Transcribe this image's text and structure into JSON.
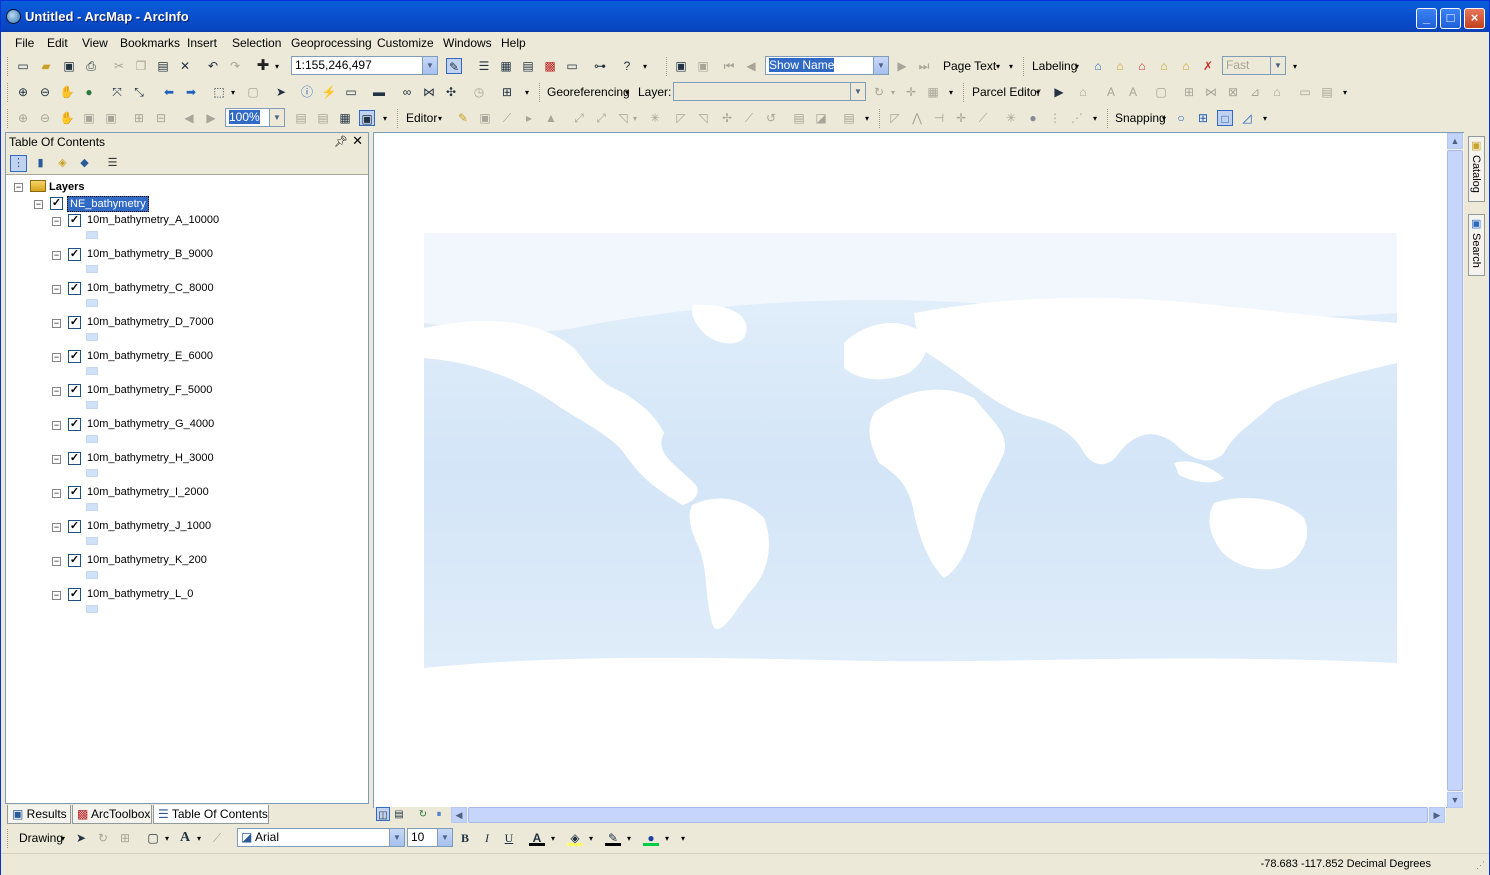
{
  "window": {
    "title": "Untitled - ArcMap - ArcInfo",
    "minimize": "_",
    "maximize": "□",
    "close": "×"
  },
  "menu": [
    "File",
    "Edit",
    "View",
    "Bookmarks",
    "Insert",
    "Selection",
    "Geoprocessing",
    "Customize",
    "Windows",
    "Help"
  ],
  "toolbar1": {
    "scale": "1:155,246,497",
    "label_field": "Show Name",
    "page_text": "Page Text",
    "labeling": "Labeling",
    "label_quality": "Fast"
  },
  "toolbar2": {
    "georeferencing": "Georeferencing",
    "layer_label": "Layer:",
    "layer_value": "",
    "parcel_editor": "Parcel Editor"
  },
  "toolbar3": {
    "zoom": "100%",
    "editor": "Editor",
    "snapping": "Snapping"
  },
  "toc": {
    "title": "Table Of Contents",
    "root": "Layers",
    "group": "NE_bathymetry",
    "layers": [
      "10m_bathymetry_A_10000",
      "10m_bathymetry_B_9000",
      "10m_bathymetry_C_8000",
      "10m_bathymetry_D_7000",
      "10m_bathymetry_E_6000",
      "10m_bathymetry_F_5000",
      "10m_bathymetry_G_4000",
      "10m_bathymetry_H_3000",
      "10m_bathymetry_I_2000",
      "10m_bathymetry_J_1000",
      "10m_bathymetry_K_200",
      "10m_bathymetry_L_0"
    ]
  },
  "bottom_tabs": [
    "Results",
    "ArcToolbox",
    "Table Of Contents"
  ],
  "side_tabs": [
    "Catalog",
    "Search"
  ],
  "drawing": {
    "label": "Drawing",
    "font": "Arial",
    "size": "10",
    "bold": "B",
    "italic": "I",
    "underline": "U"
  },
  "status": {
    "coords": "-78.683  -117.852 Decimal Degrees"
  },
  "colors": {
    "titlebar": "#0a5fd8",
    "ocean_shallow": "#e3f0fb",
    "ocean_deep": "#cfe3f6",
    "land": "#ffffff",
    "selection": "#316ac5"
  }
}
